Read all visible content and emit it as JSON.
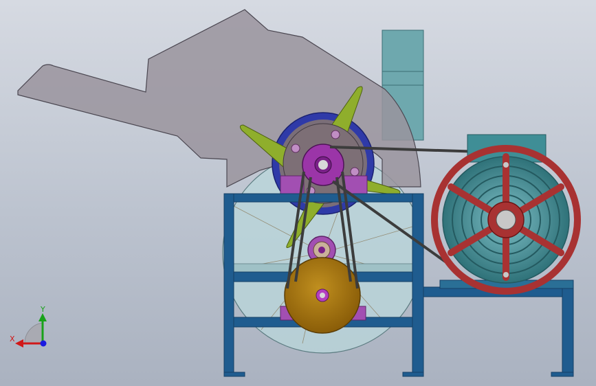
{
  "triad": {
    "x_label": "X",
    "y_label": "Y",
    "x_color": "#d01818",
    "y_color": "#19a21a",
    "z_color": "#1a1ae0"
  },
  "colors": {
    "hopper": "#9a949e",
    "frame": "#1f5c8f",
    "frame_dark": "#143f66",
    "motor": "#3f8e96",
    "motor_pulley": "#a83232",
    "belt": "#404040",
    "rotor_ring": "#2f3aa8",
    "rotor_blade": "#8fae2c",
    "hub": "#9b35a8",
    "lower_pulley": "#a8760e",
    "screen_housing": "#b8d8dc",
    "duct": "#6ea8ae"
  },
  "icons": {
    "triad": "axis-triad-icon"
  }
}
